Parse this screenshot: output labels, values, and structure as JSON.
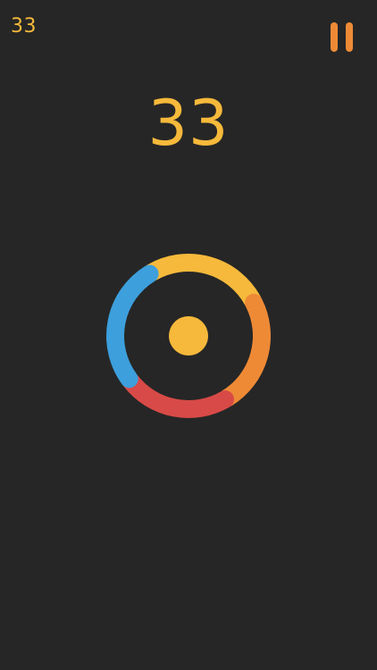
{
  "hud": {
    "score_small": "33",
    "score_large": "33"
  },
  "controls": {
    "pause_icon": "pause-icon"
  },
  "ring": {
    "segments": [
      {
        "name": "yellow",
        "color": "#F6B93B"
      },
      {
        "name": "orange",
        "color": "#EE8A36"
      },
      {
        "name": "red",
        "color": "#D84A47"
      },
      {
        "name": "blue",
        "color": "#3D9FDC"
      }
    ]
  },
  "ball": {
    "color": "#F6B93B"
  },
  "colors": {
    "background": "#262626",
    "score": "#F6B93B",
    "pause": "#EE8A36"
  }
}
